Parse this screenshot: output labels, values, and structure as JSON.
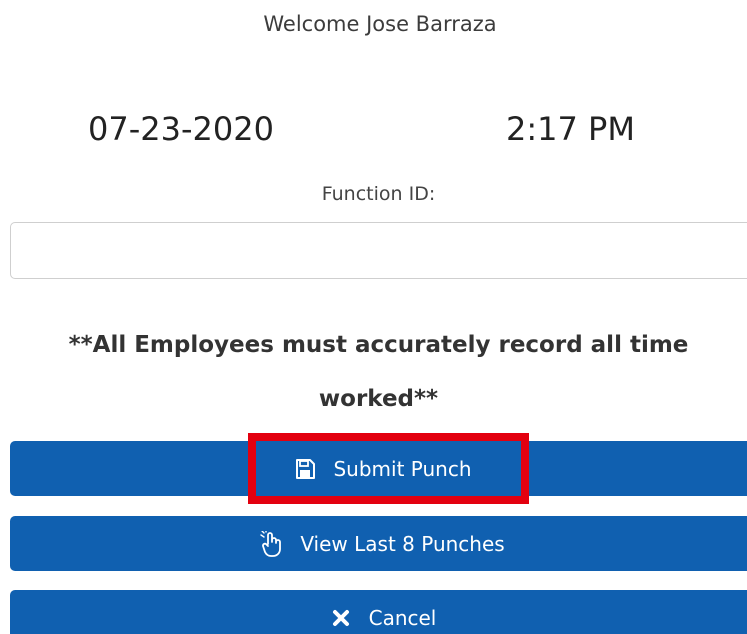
{
  "header": {
    "welcome": "Welcome Jose Barraza"
  },
  "clock": {
    "date": "07-23-2020",
    "time": "2:17 PM"
  },
  "form": {
    "function_id_label": "Function ID:",
    "function_id_value": "",
    "notice_line1": "**All Employees must accurately record all time",
    "notice_line2": "worked**"
  },
  "actions": {
    "submit_label": "Submit Punch",
    "submit_icon": "save-icon",
    "view_label": "View Last 8 Punches",
    "view_icon": "hand-pointer-icon",
    "cancel_label": "Cancel",
    "cancel_icon": "close-icon"
  },
  "colors": {
    "button_blue": "#1060b0",
    "highlight_red": "#e3000f"
  }
}
